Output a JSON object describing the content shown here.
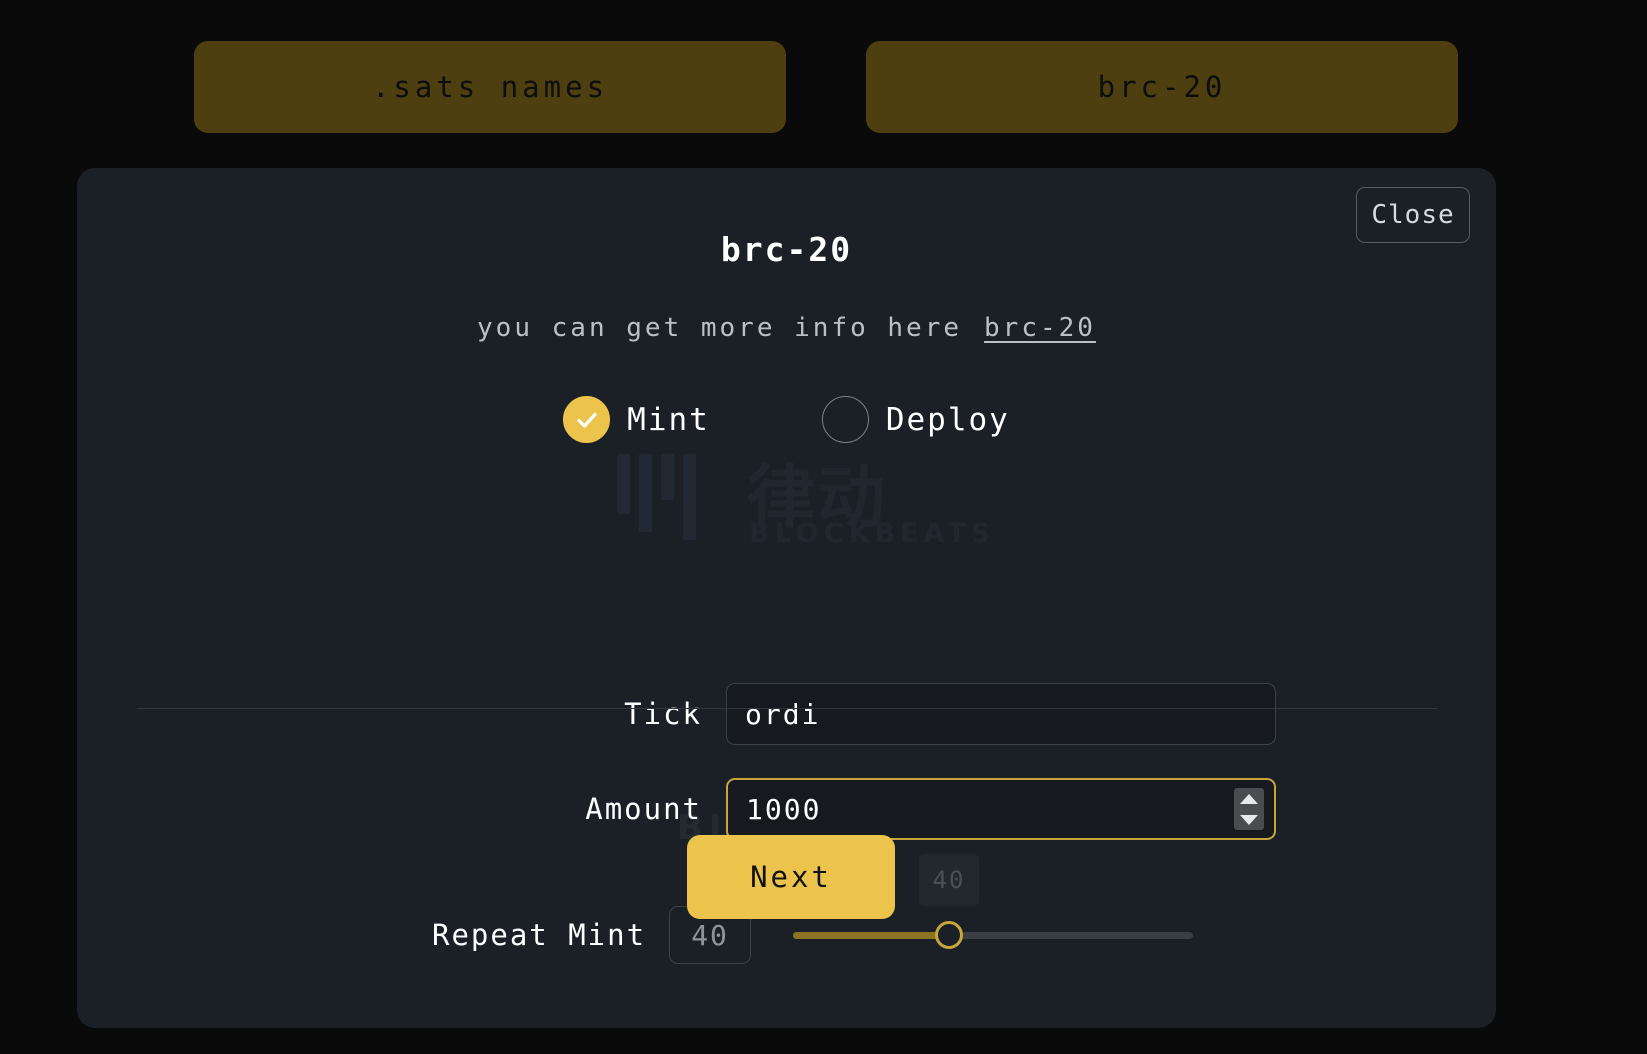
{
  "tabs": [
    {
      "label": ".sats names",
      "name": "tab-sats-names"
    },
    {
      "label": "brc-20",
      "name": "tab-brc-20"
    }
  ],
  "modal": {
    "title": "brc-20",
    "close_label": "Close",
    "info_prefix": "you can get more info here",
    "info_link": "brc-20",
    "mode_options": [
      {
        "label": "Mint",
        "selected": true
      },
      {
        "label": "Deploy",
        "selected": false
      }
    ],
    "fields": {
      "tick": {
        "label": "Tick",
        "value": "ordi",
        "placeholder": "tick"
      },
      "amount": {
        "label": "Amount",
        "value": "1000",
        "placeholder": "amount"
      }
    },
    "repeat_mint": {
      "label": "Repeat Mint",
      "badge_value": "40",
      "slider_value": "40",
      "tooltip_value": "40"
    },
    "next_label": "Next"
  },
  "watermark": {
    "cjk": "律动",
    "name": "BLOCKBEATS",
    "secondary": "BLOCKBEATS"
  },
  "colors": {
    "accent": "#edc44b",
    "tab_bg": "#4d3f10",
    "modal_bg": "#1b2026",
    "page_bg": "#0a0a0a",
    "input_bg": "#16191d",
    "focus_border": "#c7a63c"
  }
}
